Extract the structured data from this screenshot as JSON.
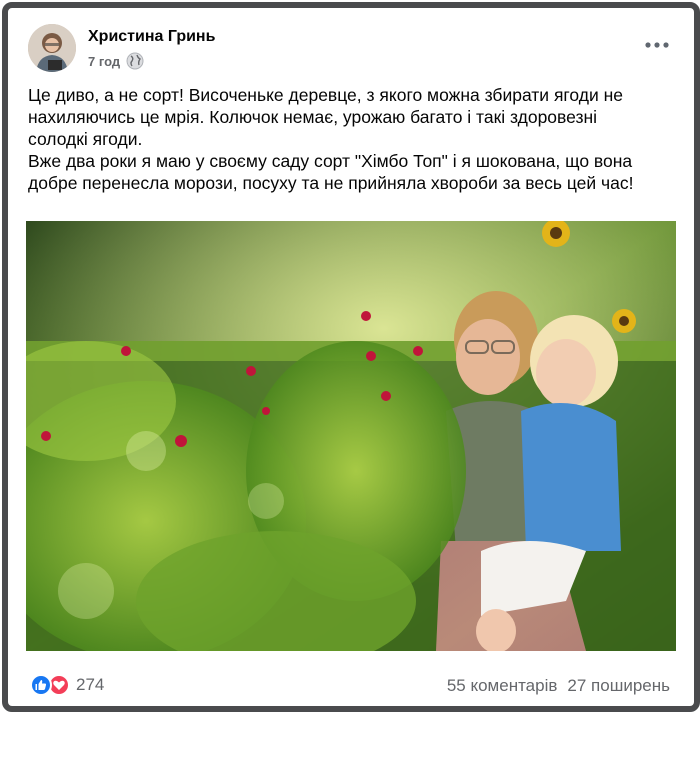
{
  "post": {
    "author": "Христина Гринь",
    "time": "7 год",
    "text_lines": [
      "Це диво, а не сорт! Височеньке деревце, з якого можна збирати ягоди не",
      "нахиляючись це мрія. Колючок немає, урожаю багато і такі здоровезні",
      "солодкі ягоди.",
      "Вже два роки я маю у своєму саду сорт \"Хімбо Топ\" і я шокована, що вона",
      "добре перенесла морози, посуху та не прийняла хвороби за весь цей час!"
    ],
    "reaction_count": "274",
    "comments": "55 коментарів",
    "shares": "27 поширень"
  },
  "colors": {
    "frame": "#4a4b4d",
    "like": "#1877f2",
    "love": "#f33e58",
    "muted_text": "#65676b"
  },
  "icons": [
    "globe-icon",
    "more-options-icon",
    "like-icon",
    "love-icon"
  ]
}
